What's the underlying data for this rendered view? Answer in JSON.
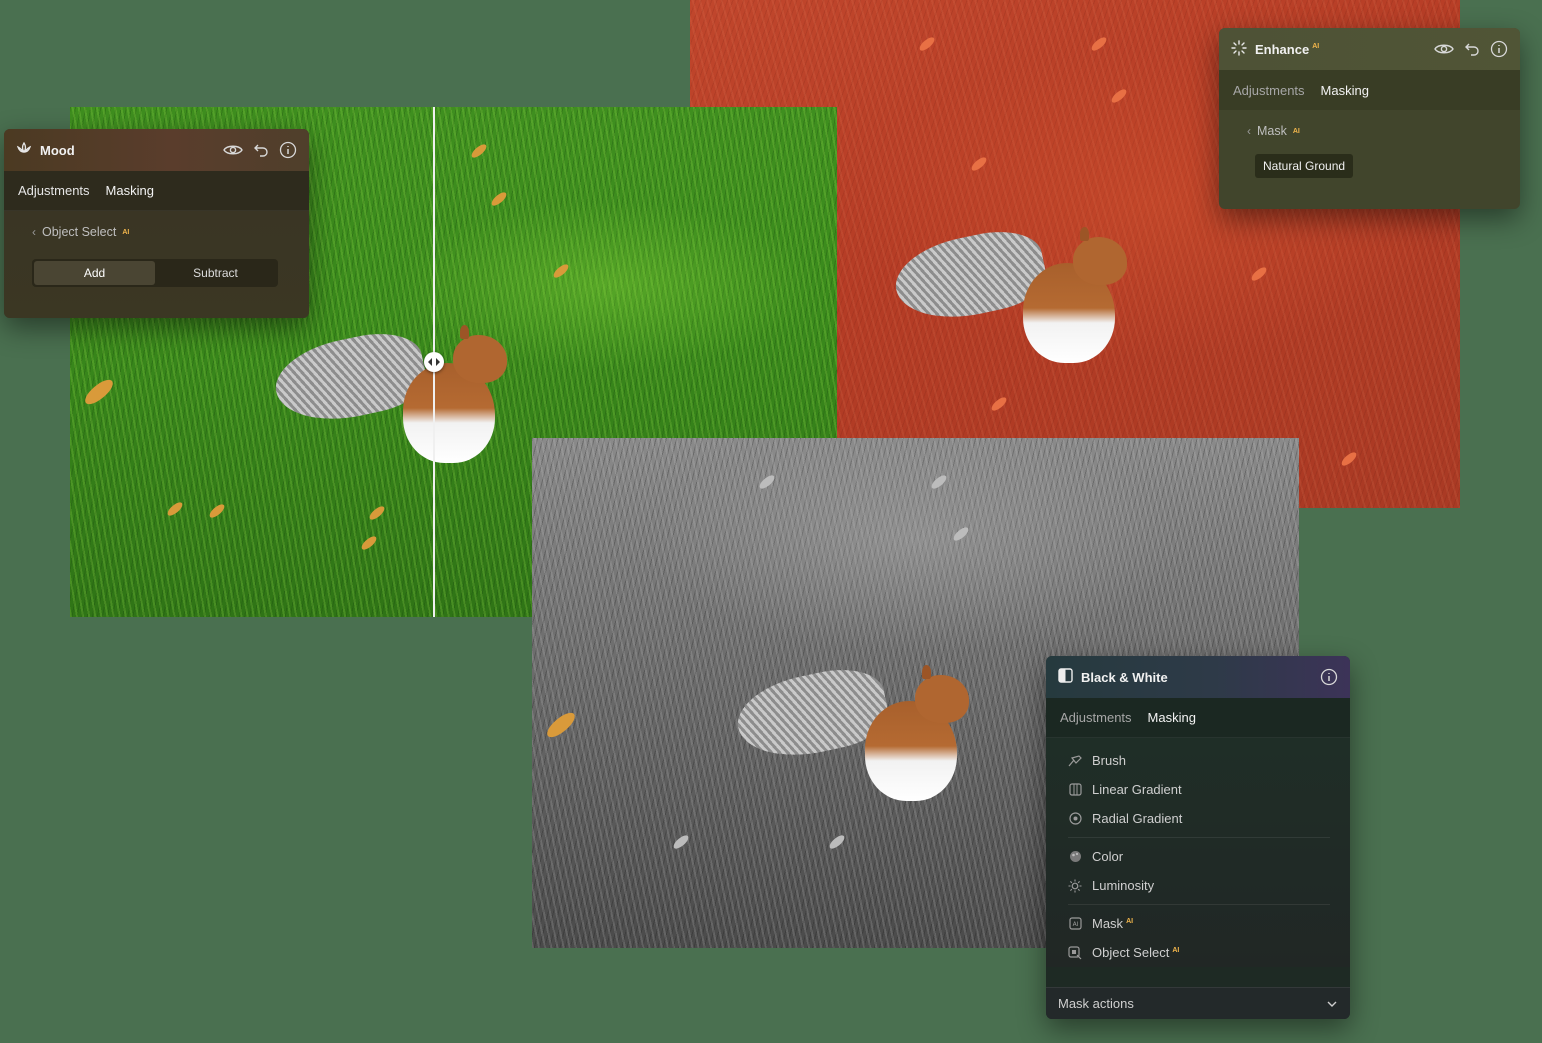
{
  "mood_panel": {
    "title": "Mood",
    "tabs": [
      "Adjustments",
      "Masking"
    ],
    "active_tab": "Masking",
    "back_label": "Object Select",
    "back_badge": "AI",
    "segment": {
      "add": "Add",
      "subtract": "Subtract",
      "selected": "Add"
    },
    "icon": "mood-icon"
  },
  "enhance_panel": {
    "title": "Enhance",
    "title_badge": "AI",
    "tabs": [
      "Adjustments",
      "Masking"
    ],
    "active_tab": "Masking",
    "back_label": "Mask",
    "back_badge": "AI",
    "chip": "Natural Ground",
    "icon": "sparkle-icon"
  },
  "bw_panel": {
    "title": "Black & White",
    "tabs": [
      "Adjustments",
      "Masking"
    ],
    "active_tab": "Masking",
    "icon": "half-square-icon",
    "items": [
      {
        "label": "Brush",
        "icon": "brush-icon",
        "badge": ""
      },
      {
        "label": "Linear Gradient",
        "icon": "linear-gradient-icon",
        "badge": ""
      },
      {
        "label": "Radial Gradient",
        "icon": "radial-gradient-icon",
        "badge": ""
      },
      {
        "label": "Color",
        "icon": "color-icon",
        "badge": ""
      },
      {
        "label": "Luminosity",
        "icon": "luminosity-icon",
        "badge": ""
      },
      {
        "label": "Mask",
        "icon": "ai-mask-icon",
        "badge": "AI"
      },
      {
        "label": "Object Select",
        "icon": "object-select-icon",
        "badge": "AI"
      }
    ],
    "footer": "Mask actions"
  },
  "colors": {
    "background": "#4a7050",
    "ai_badge": "#f2b64c",
    "mask_overlay": "#c0462c"
  }
}
